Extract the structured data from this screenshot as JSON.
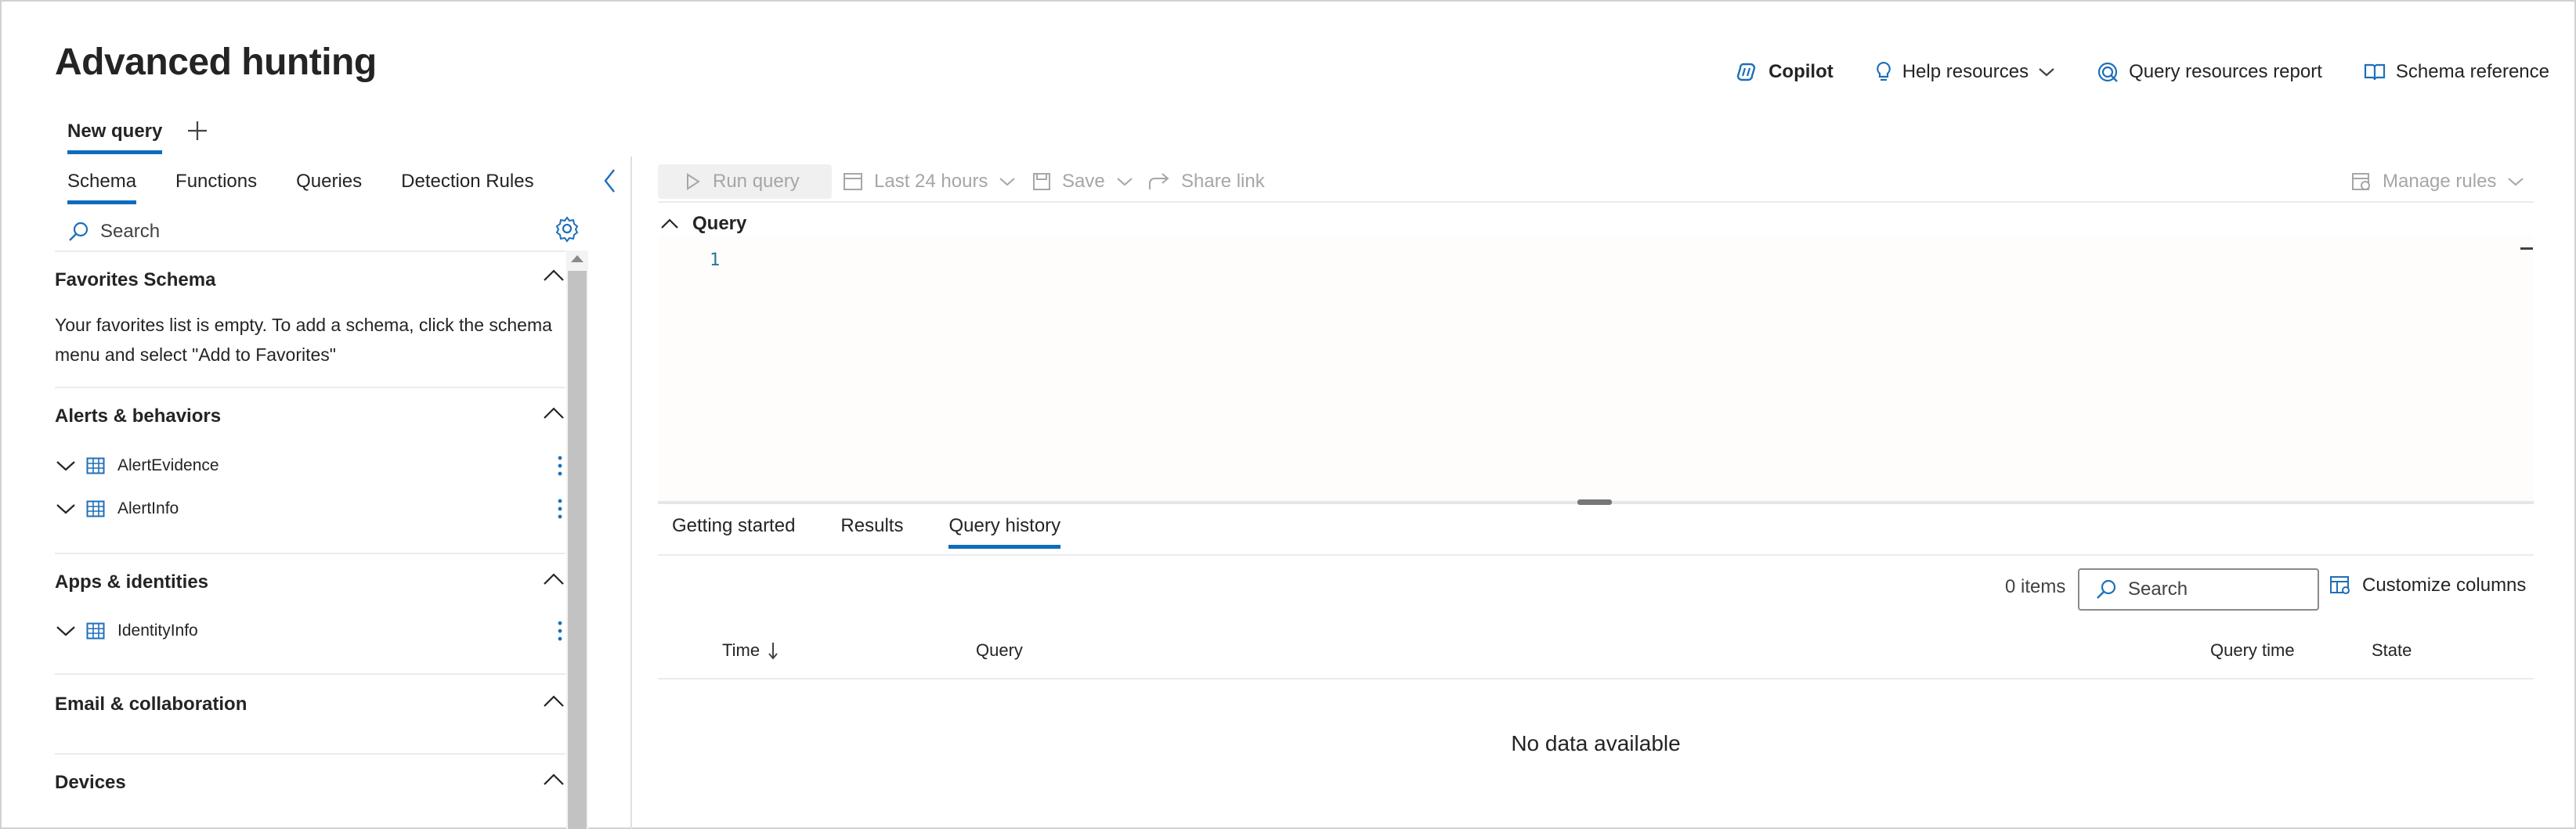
{
  "header": {
    "title": "Advanced hunting",
    "actions": [
      {
        "label": "Copilot",
        "icon": "copilot-icon"
      },
      {
        "label": "Help resources",
        "icon": "lightbulb-icon"
      },
      {
        "label": "Query resources report",
        "icon": "query-resources-icon"
      },
      {
        "label": "Schema reference",
        "icon": "book-icon"
      }
    ]
  },
  "query_tabs": {
    "active": "New query",
    "add_icon": "plus-icon"
  },
  "left_panel": {
    "tabs": [
      "Schema",
      "Functions",
      "Queries",
      "Detection Rules"
    ],
    "active_tab": "Schema",
    "search_placeholder": "Search",
    "sections": {
      "favorites": {
        "title": "Favorites Schema",
        "empty_message": "Your favorites list is empty. To add a schema, click the schema menu and select \"Add to Favorites\""
      },
      "alerts": {
        "title": "Alerts & behaviors",
        "tables": [
          "AlertEvidence",
          "AlertInfo"
        ]
      },
      "apps": {
        "title": "Apps & identities",
        "tables": [
          "IdentityInfo"
        ]
      },
      "email": {
        "title": "Email & collaboration"
      },
      "devices": {
        "title": "Devices"
      }
    }
  },
  "toolbar": {
    "run_query": "Run query",
    "time_range": "Last 24 hours",
    "save": "Save",
    "share_link": "Share link",
    "manage_rules": "Manage rules"
  },
  "editor": {
    "section_title": "Query",
    "line_number": "1"
  },
  "results": {
    "tabs": [
      "Getting started",
      "Results",
      "Query history"
    ],
    "active_tab": "Query history",
    "items_count": "0 items",
    "search_placeholder": "Search",
    "customize_columns": "Customize columns",
    "columns": {
      "time": "Time",
      "query": "Query",
      "query_time": "Query time",
      "state": "State"
    },
    "empty_message": "No data available"
  },
  "colors": {
    "accent": "#0f6cbd",
    "text": "#242424",
    "disabled": "#a6a6a6",
    "icon_blue": "#2b6cb0"
  }
}
